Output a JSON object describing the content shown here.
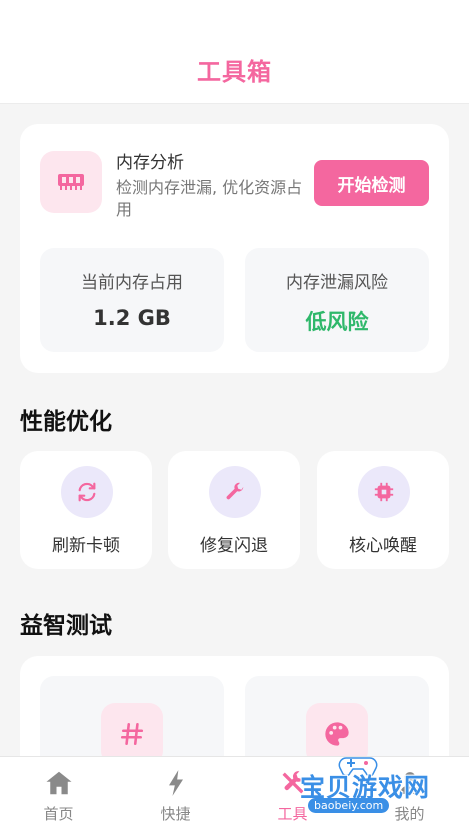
{
  "header": {
    "title": "工具箱"
  },
  "memory": {
    "icon": "ram-icon",
    "title": "内存分析",
    "description": "检测内存泄漏, 优化资源占用",
    "start_button": "开始检测",
    "stats": [
      {
        "label": "当前内存占用",
        "value": "1.2 GB"
      },
      {
        "label": "内存泄漏风险",
        "value": "低风险"
      }
    ]
  },
  "performance": {
    "section_title": "性能优化",
    "items": [
      {
        "label": "刷新卡顿",
        "icon": "refresh-icon"
      },
      {
        "label": "修复闪退",
        "icon": "wrench-icon"
      },
      {
        "label": "核心唤醒",
        "icon": "chip-icon"
      }
    ]
  },
  "puzzle": {
    "section_title": "益智测试",
    "items": [
      {
        "icon": "hash-icon"
      },
      {
        "icon": "palette-icon"
      }
    ]
  },
  "nav": {
    "items": [
      {
        "label": "首页",
        "icon": "home-icon"
      },
      {
        "label": "快捷",
        "icon": "lightning-icon"
      },
      {
        "label": "工具",
        "icon": "tools-icon",
        "active": true
      },
      {
        "label": "我的",
        "icon": "user-icon"
      }
    ]
  },
  "watermark": {
    "text": "宝贝游戏网",
    "url": "baobeiy.com"
  },
  "colors": {
    "accent": "#f4679f",
    "success": "#2fb86b",
    "icon_bg_pink": "#fde6ee",
    "icon_bg_purple": "#ebe8fa"
  }
}
